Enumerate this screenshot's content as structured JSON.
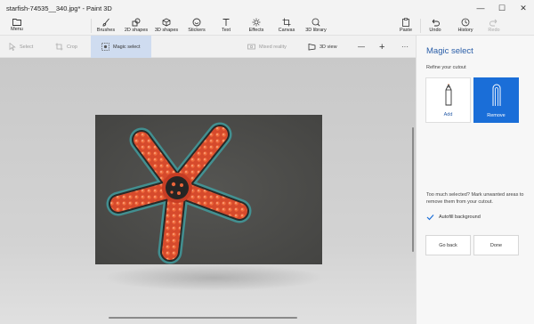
{
  "window": {
    "title": "starfish-74535__340.jpg* - Paint 3D",
    "minimize": "—",
    "maximize": "☐",
    "close": "✕"
  },
  "ribbon": {
    "menu": "Menu",
    "tools": [
      "Brushes",
      "2D shapes",
      "3D shapes",
      "Stickers",
      "Text",
      "Effects",
      "Canvas",
      "3D library"
    ],
    "paste": "Paste",
    "undo": "Undo",
    "history": "History",
    "redo": "Redo"
  },
  "toolbar": {
    "select": "Select",
    "crop": "Crop",
    "magic_select": "Magic select",
    "mixed_reality": "Mixed reality",
    "view_3d": "3D view",
    "zoom_out": "—",
    "zoom_in": "+",
    "more": "···"
  },
  "panel": {
    "title": "Magic select",
    "subtitle": "Refine your cutout",
    "add": "Add",
    "remove": "Remove",
    "help_text": "Too much selected? Mark unwanted areas to remove them from your cutout.",
    "autofill": "Autofill background",
    "go_back": "Go back",
    "done": "Done"
  },
  "colors": {
    "accent": "#1a6ed8",
    "panel_title": "#2a5ea8",
    "selection_bg": "#cfdcf0"
  }
}
